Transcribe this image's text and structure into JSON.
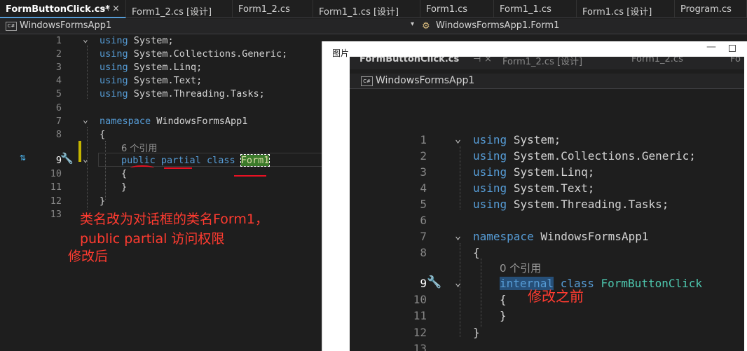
{
  "tabs": [
    {
      "label": "FormButtonClick.cs*",
      "active": true
    },
    {
      "label": "Form1_2.cs [设计]"
    },
    {
      "label": "Form1_2.cs"
    },
    {
      "label": "Form1_1.cs [设计]"
    },
    {
      "label": "Form1.cs"
    },
    {
      "label": "Form1_1.cs"
    },
    {
      "label": "Form1.cs [设计]"
    },
    {
      "label": "Program.cs"
    }
  ],
  "tab_pin": "⊣",
  "tab_close": "×",
  "nav": {
    "project": "WindowsFormsApp1",
    "project_icon": "C#",
    "class": "WindowsFormsApp1.Form1",
    "dropdown": "▾"
  },
  "editor": {
    "line_numbers": [
      "1",
      "2",
      "3",
      "4",
      "5",
      "6",
      "7",
      "8",
      "9",
      "10",
      "11",
      "12",
      "13"
    ],
    "usings": [
      "System;",
      "System.Collections.Generic;",
      "System.Linq;",
      "System.Text;",
      "System.Threading.Tasks;"
    ],
    "kw_using": "using",
    "kw_namespace": "namespace",
    "namespace_name": "WindowsFormsApp1",
    "brace_open": "{",
    "brace_close": "}",
    "ref_hint": "6 个引用",
    "kw_public": "public",
    "kw_partial": "partial",
    "kw_class": "class",
    "class_name": "Form1",
    "fold_glyph": "⌄"
  },
  "annotations": {
    "line1": "类名改为对话框的类名Form1，",
    "line2": "public partial 访问权限",
    "line3": "修改后"
  },
  "viewer": {
    "title": "图片",
    "minimize": "—",
    "shot_tabs": [
      "FormButtonClick.cs",
      "⊣",
      "×",
      "Form1_2.cs [设计]",
      "Form1_2.cs",
      "Fo"
    ],
    "shot_project": "WindowsFormsApp1",
    "shot_project_icon": "C#",
    "ref_hint": "0 个引用",
    "kw_internal": "internal",
    "kw_class": "class",
    "class_name": "FormButtonClick",
    "annotation": "修改之前"
  },
  "colors": {
    "keyword": "#569cd6",
    "type": "#4ec9b0",
    "annotation_red": "#ff3b30",
    "active_tab_accent": "#569cd6"
  }
}
